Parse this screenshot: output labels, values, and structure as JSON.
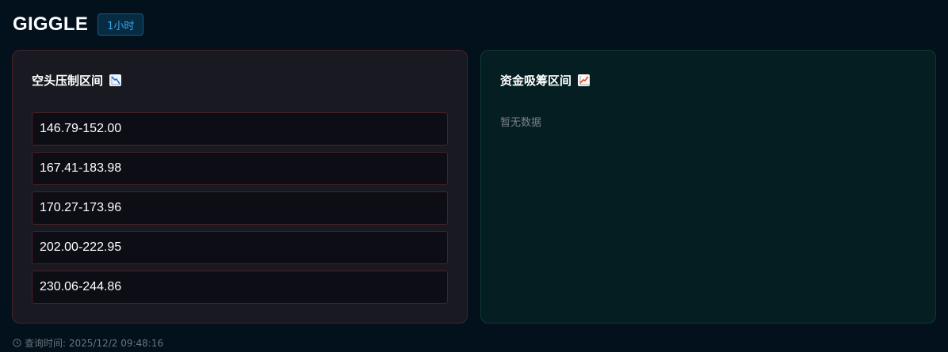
{
  "header": {
    "title": "GIGGLE",
    "timeframe_badge": "1小时"
  },
  "short_pressure": {
    "title": "空头压制区间",
    "icon": "chart-decreasing-icon",
    "ranges": [
      "146.79-152.00",
      "167.41-183.98",
      "170.27-173.96",
      "202.00-222.95",
      "230.06-244.86"
    ],
    "accent_color": "#4a2228"
  },
  "accumulation": {
    "title": "资金吸筹区间",
    "icon": "chart-increasing-icon",
    "empty_text": "暂无数据",
    "accent_color": "#0f3a35"
  },
  "footer": {
    "icon": "clock-icon",
    "query_time": "查询时间: 2025/12/2 09:48:16"
  }
}
